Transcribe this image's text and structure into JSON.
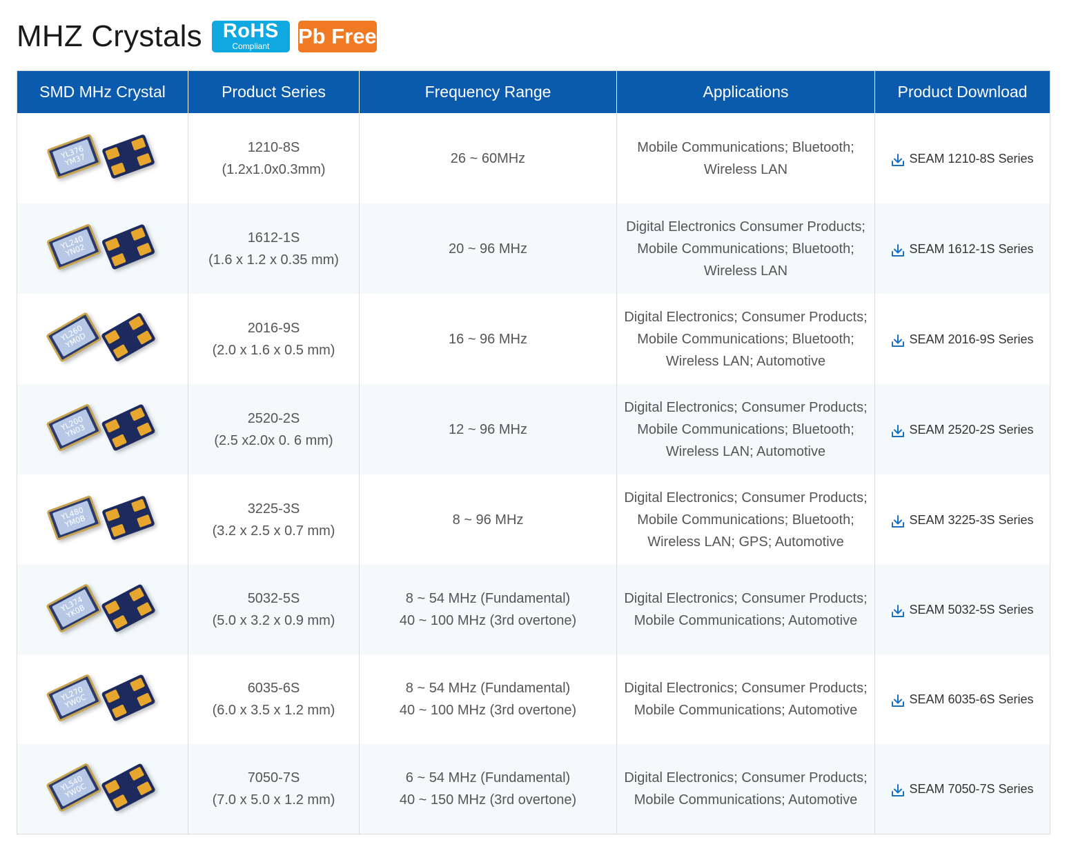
{
  "page": {
    "title": "MHZ Crystals",
    "badges": {
      "rohs_main": "RoHS",
      "rohs_sub": "Compliant",
      "pb": "Pb Free"
    }
  },
  "colors": {
    "header_bg": "#0a5bad",
    "rohs_badge": "#10a8e0",
    "pb_badge": "#f07a24",
    "row_alt": "#f4f9fc",
    "download_icon": "#1a70c0"
  },
  "table": {
    "headers": [
      "SMD MHz Crystal",
      "Product Series",
      "Frequency Range",
      "Applications",
      "Product Download"
    ],
    "rows": [
      {
        "lid_lines": [
          "YL376",
          "YM37"
        ],
        "series": [
          "1210-8S",
          "(1.2x1.0x0.3mm)"
        ],
        "frequency": [
          "26 ~ 60MHz"
        ],
        "applications": [
          "Mobile Communications; Bluetooth;",
          "Wireless LAN"
        ],
        "download": "SEAM 1210-8S Series"
      },
      {
        "lid_lines": [
          "YL240",
          "YN02"
        ],
        "series": [
          "1612-1S",
          "(1.6 x 1.2 x 0.35 mm)"
        ],
        "frequency": [
          "20 ~ 96 MHz"
        ],
        "applications": [
          "Digital Electronics Consumer Products;",
          "Mobile Communications; Bluetooth;",
          "Wireless LAN"
        ],
        "download": "SEAM 1612-1S Series"
      },
      {
        "lid_lines": [
          "YL260",
          "YM0D"
        ],
        "series": [
          "2016-9S",
          "(2.0 x 1.6 x 0.5 mm)"
        ],
        "frequency": [
          "16 ~ 96 MHz"
        ],
        "applications": [
          "Digital Electronics; Consumer Products;",
          "Mobile Communications; Bluetooth;",
          "Wireless LAN; Automotive"
        ],
        "download": "SEAM 2016-9S Series"
      },
      {
        "lid_lines": [
          "YL200",
          "YN03"
        ],
        "series": [
          "2520-2S",
          "(2.5 x2.0x 0. 6 mm)"
        ],
        "frequency": [
          "12 ~ 96 MHz"
        ],
        "applications": [
          "Digital Electronics; Consumer Products;",
          "Mobile Communications; Bluetooth;",
          "Wireless LAN; Automotive"
        ],
        "download": "SEAM 2520-2S Series"
      },
      {
        "lid_lines": [
          "YL480",
          "YM0B"
        ],
        "series": [
          "3225-3S",
          "(3.2 x 2.5 x 0.7 mm)"
        ],
        "frequency": [
          "8 ~ 96 MHz"
        ],
        "applications": [
          "Digital Electronics; Consumer Products;",
          "Mobile Communications; Bluetooth;",
          "Wireless LAN; GPS; Automotive"
        ],
        "download": "SEAM 3225-3S Series"
      },
      {
        "lid_lines": [
          "YL374",
          "YK0B"
        ],
        "series": [
          "5032-5S",
          "(5.0 x 3.2 x 0.9 mm)"
        ],
        "frequency": [
          "8 ~ 54 MHz (Fundamental)",
          "40 ~ 100 MHz (3rd overtone)"
        ],
        "applications": [
          "Digital Electronics; Consumer Products;",
          "Mobile Communications; Automotive"
        ],
        "download": "SEAM 5032-5S Series"
      },
      {
        "lid_lines": [
          "YL270",
          "YW0C"
        ],
        "series": [
          "6035-6S",
          "(6.0 x 3.5 x 1.2 mm)"
        ],
        "frequency": [
          "8 ~ 54 MHz (Fundamental)",
          "40 ~ 100 MHz (3rd overtone)"
        ],
        "applications": [
          "Digital Electronics; Consumer Products;",
          "Mobile Communications; Automotive"
        ],
        "download": "SEAM 6035-6S Series"
      },
      {
        "lid_lines": [
          "YL540",
          "YW0C"
        ],
        "series": [
          "7050-7S",
          "(7.0 x 5.0 x 1.2 mm)"
        ],
        "frequency": [
          "6 ~ 54 MHz (Fundamental)",
          "40 ~ 150 MHz (3rd overtone)"
        ],
        "applications": [
          "Digital Electronics; Consumer Products;",
          "Mobile Communications; Automotive"
        ],
        "download": "SEAM 7050-7S Series"
      }
    ]
  }
}
